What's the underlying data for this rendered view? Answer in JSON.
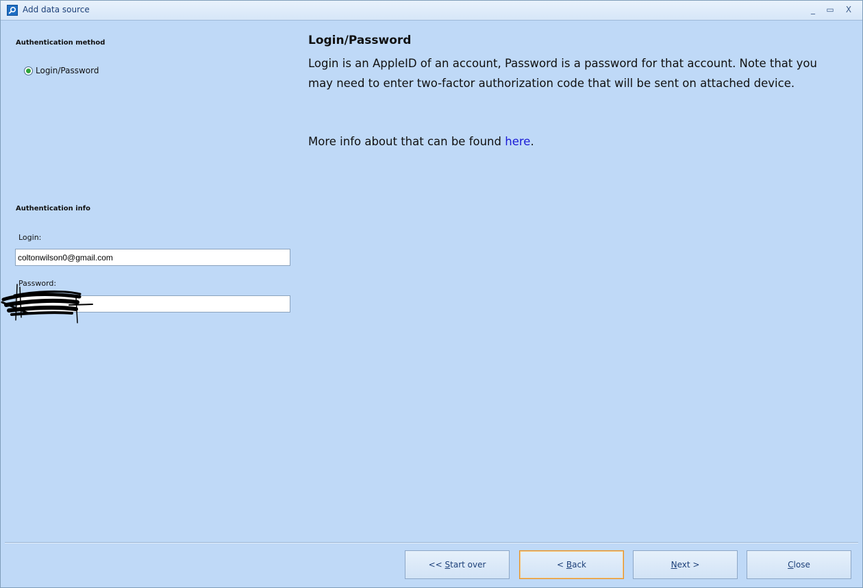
{
  "window": {
    "title": "Add data source",
    "controls": {
      "minimize": "_",
      "maximize": "▭",
      "close": "X"
    }
  },
  "left_panel": {
    "auth_method_heading": "Authentication method",
    "auth_method_options": [
      {
        "label": "Login/Password",
        "selected": true
      }
    ],
    "auth_info_heading": "Authentication info",
    "login_label": "Login:",
    "login_value": "coltonwilson0@gmail.com",
    "password_label": "Password:",
    "password_value": ""
  },
  "right_panel": {
    "title": "Login/Password",
    "body": "Login is an AppleID of an account, Password is a password for that account. Note that you may need to enter two-factor authorization code that will be sent on attached device.",
    "more_prefix": "More info about that can be found ",
    "more_link": "here",
    "more_suffix": "."
  },
  "footer": {
    "start_over_prefix": "<< ",
    "start_over_accel": "S",
    "start_over_rest": "tart over",
    "back_prefix": "< ",
    "back_accel": "B",
    "back_rest": "ack",
    "next_accel": "N",
    "next_rest": "ext >",
    "close_accel": "C",
    "close_rest": "lose"
  },
  "colors": {
    "background": "#bfd9f7",
    "link": "#1a1ad6",
    "radio_selected": "#2ea53a",
    "focus_border": "#e2932f"
  }
}
